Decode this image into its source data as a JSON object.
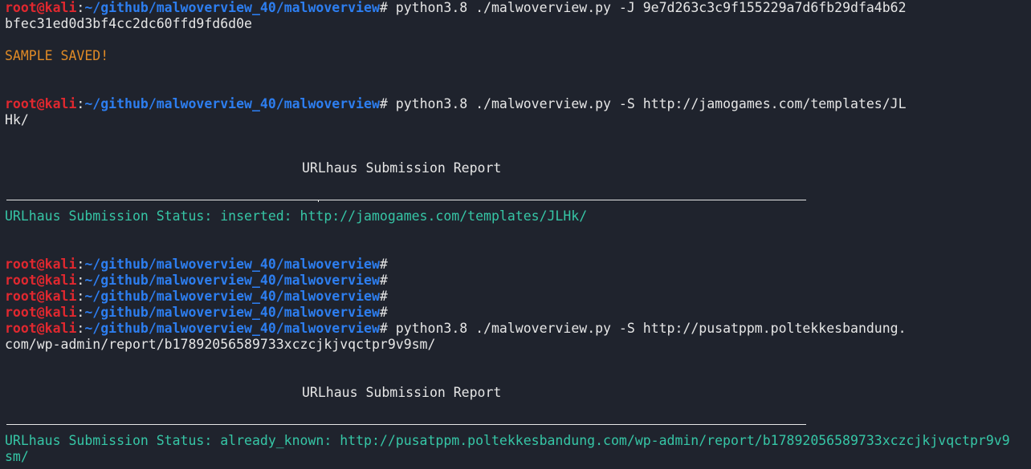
{
  "prompt": {
    "user": "root@kali",
    "colon": ":",
    "path": "~/github/malwoverview_40/malwoverview",
    "hash": "#"
  },
  "commands": {
    "cmd1_line1": " python3.8 ./malwoverview.py -J 9e7d263c3c9f155229a7d6fb29dfa4b62",
    "cmd1_line2": "bfec31ed0d3bf4cc2dc60ffd9fd6d0e",
    "cmd2_line1": " python3.8 ./malwoverview.py -S http://jamogames.com/templates/JL",
    "cmd2_line2": "Hk/",
    "cmd3_line1": " python3.8 ./malwoverview.py -S http://pusatppm.poltekkesbandung.",
    "cmd3_line2": "com/wp-admin/report/b17892056589733xczcjkjvqctpr9v9sm/"
  },
  "output": {
    "sample_saved": "SAMPLE SAVED!",
    "report_title_1": "URLhaus Submission Report",
    "status_1": "URLhaus Submission Status: inserted: http://jamogames.com/templates/JLHk/",
    "report_title_2": "URLhaus Submission Report",
    "status_2_line1": "URLhaus Submission Status: already_known: http://pusatppm.poltekkesbandung.com/wp-admin/report/b17892056589733xczcjkjvqctpr9v9",
    "status_2_line2": "sm/"
  },
  "colors": {
    "background": "#1f232d",
    "user": "#e0282f",
    "path": "#2d7ef0",
    "warning": "#e08a26",
    "success": "#36c6a6",
    "text": "#e6e6e6"
  }
}
